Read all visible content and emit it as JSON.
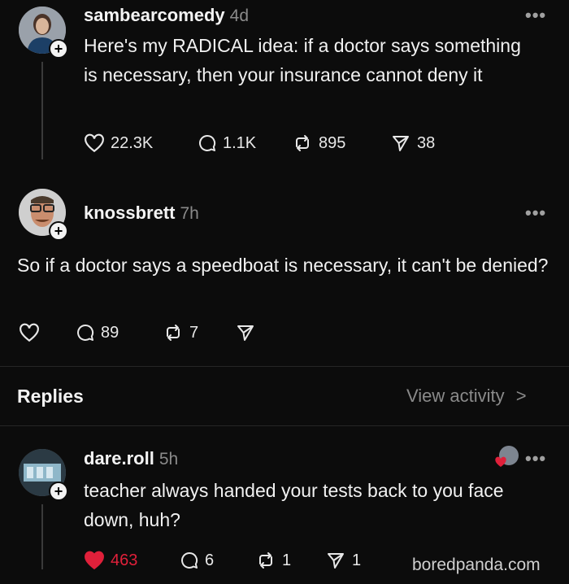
{
  "post": {
    "username": "sambearcomedy",
    "time": "4d",
    "text": "Here's my RADICAL idea: if a doctor says something is necessary, then your  insurance cannot deny it",
    "likes": "22.3K",
    "comments": "1.1K",
    "reposts": "895",
    "shares": "38"
  },
  "reply1": {
    "username": "knossbrett",
    "time": "7h",
    "text": "So if a doctor says a speedboat is necessary, it can't be denied?",
    "likes": "",
    "comments": "89",
    "reposts": "7",
    "shares": ""
  },
  "replies_header": {
    "title": "Replies",
    "view_activity": "View activity",
    "chevron": ">"
  },
  "reply2": {
    "username": "dare.roll",
    "time": "5h",
    "text": "teacher always handed your tests back to you face down, huh?",
    "likes": "463",
    "comments": "6",
    "reposts": "1",
    "shares": "1"
  },
  "more_label": "•••",
  "plus_label": "+",
  "watermark": "boredpanda.com",
  "colors": {
    "background": "#0c0c0c",
    "liked": "#e0203a",
    "muted": "#8a8a8a"
  }
}
